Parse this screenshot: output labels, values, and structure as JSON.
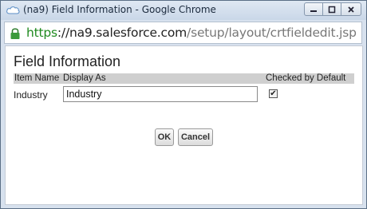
{
  "window": {
    "title": "(na9) Field Information - Google Chrome",
    "controls": {
      "minimize": "minimize-icon",
      "maximize": "maximize-icon",
      "close": "close-icon"
    }
  },
  "address_bar": {
    "url_scheme": "https",
    "url_host": "://na9.salesforce.com",
    "url_path": "/setup/layout/crtfieldedit.jsp",
    "secure_icon": "lock-icon"
  },
  "page": {
    "heading": "Field Information",
    "table": {
      "headers": [
        "Item Name",
        "Display As",
        "Checked by Default"
      ],
      "row": {
        "item_name": "Industry",
        "display_as": "Industry",
        "checked": "✔"
      }
    },
    "buttons": {
      "ok": "OK",
      "cancel": "Cancel"
    }
  },
  "colors": {
    "header_bg": "#cfcfcf",
    "https_green": "#1f8a1f"
  }
}
